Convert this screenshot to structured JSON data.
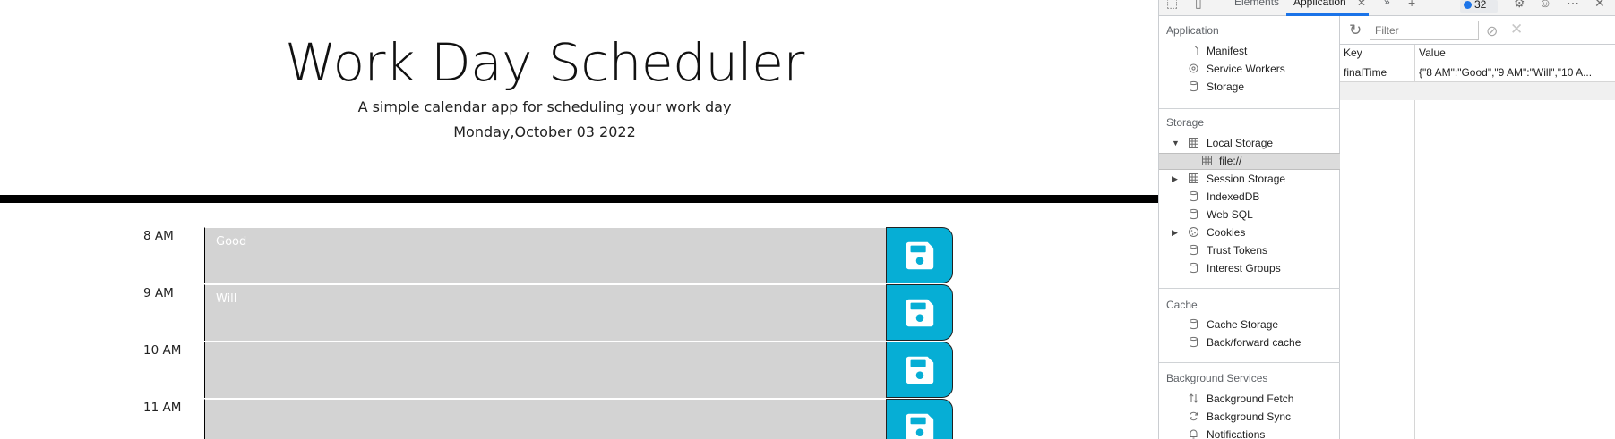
{
  "scheduler": {
    "title": "Work Day Scheduler",
    "lead": "A simple calendar app for scheduling your work day",
    "current_day": "Monday,October 03 2022",
    "time_blocks": [
      {
        "hour": "8 AM",
        "text": "Good"
      },
      {
        "hour": "9 AM",
        "text": "Will"
      },
      {
        "hour": "10 AM",
        "text": ""
      },
      {
        "hour": "11 AM",
        "text": ""
      }
    ],
    "save_icon": "floppy-disk-icon",
    "colors": {
      "past": "#d3d3d3",
      "save_button": "#06aed5"
    }
  },
  "devtools": {
    "tabs": {
      "elements": "Elements",
      "application": "Application",
      "more": "»",
      "issues_count": "32"
    },
    "sidebar": {
      "application_title": "Application",
      "application_items": [
        "Manifest",
        "Service Workers",
        "Storage"
      ],
      "storage_title": "Storage",
      "storage_items": [
        "Local Storage",
        "file://",
        "Session Storage",
        "IndexedDB",
        "Web SQL",
        "Cookies",
        "Trust Tokens",
        "Interest Groups"
      ],
      "cache_title": "Cache",
      "cache_items": [
        "Cache Storage",
        "Back/forward cache"
      ],
      "background_title": "Background Services",
      "background_items": [
        "Background Fetch",
        "Background Sync",
        "Notifications"
      ]
    },
    "storage_view": {
      "filter_placeholder": "Filter",
      "columns": [
        "Key",
        "Value"
      ],
      "rows": [
        {
          "key": "finalTime",
          "value": "{\"8 AM\":\"Good\",\"9 AM\":\"Will\",\"10 A..."
        }
      ]
    }
  }
}
